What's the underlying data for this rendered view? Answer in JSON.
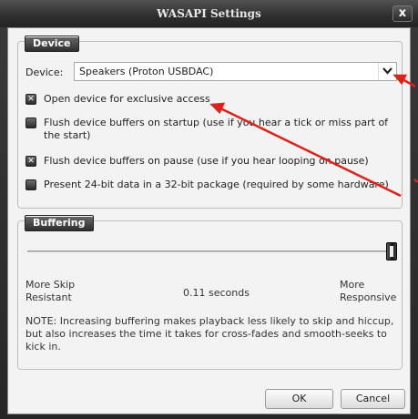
{
  "window": {
    "title": "WASAPI Settings",
    "close_label": "x"
  },
  "device_group": {
    "header": "Device",
    "device_label": "Device:",
    "device_value": "Speakers (Proton USBDAC)",
    "options": [
      {
        "label": "Open device for exclusive access",
        "checked": true,
        "mark": "✕"
      },
      {
        "label": "Flush device buffers on startup (use if you hear a tick or miss part of the start)",
        "checked": false,
        "mark": ""
      },
      {
        "label": "Flush device buffers on pause (use if you hear looping on pause)",
        "checked": true,
        "mark": "✕"
      },
      {
        "label": "Present 24-bit data in a 32-bit package (required by some hardware)",
        "checked": false,
        "mark": ""
      }
    ]
  },
  "buffer_group": {
    "header": "Buffering",
    "slider_value_fraction": 1.0,
    "left_label": "More Skip Resistant",
    "value_label": "0.11 seconds",
    "right_label": "More Responsive",
    "note": "NOTE: Increasing buffering makes playback less likely to skip and hiccup, but also increases the time it takes for cross-fades and smooth-seeks to kick in."
  },
  "buttons": {
    "ok": "OK",
    "cancel": "Cancel"
  },
  "annotation_color": "#e0201a"
}
